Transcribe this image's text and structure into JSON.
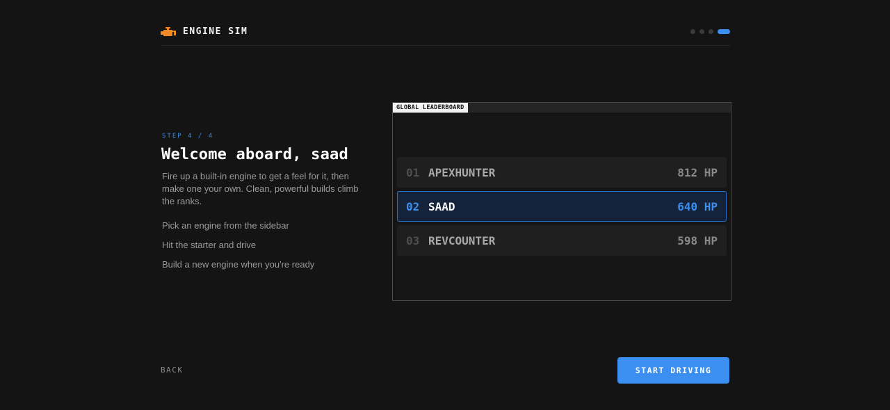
{
  "header": {
    "brand_icon": "engine-icon",
    "title": "ENGINE SIM",
    "progress": {
      "total_steps": 4,
      "current_step": 4
    }
  },
  "intro": {
    "step_label": "STEP 4 / 4",
    "heading": "Welcome aboard, saad",
    "description": "Fire up a built-in engine to get a feel for it, then make one your own. Clean, powerful builds climb the ranks.",
    "tips": [
      "Pick an engine from the sidebar",
      "Hit the starter and drive",
      "Build a new engine when you're ready"
    ]
  },
  "leaderboard": {
    "title": "GLOBAL LEADERBOARD",
    "rows": [
      {
        "rank": "01",
        "name": "APEXHUNTER",
        "score": "812 HP",
        "highlighted": false
      },
      {
        "rank": "02",
        "name": "SAAD",
        "score": "640 HP",
        "highlighted": true
      },
      {
        "rank": "03",
        "name": "REVCOUNTER",
        "score": "598 HP",
        "highlighted": false
      }
    ]
  },
  "footer": {
    "back_label": "BACK",
    "start_label": "START DRIVING"
  },
  "colors": {
    "background": "#141414",
    "accent": "#3b8ff0",
    "brand_icon": "#f08a24"
  }
}
